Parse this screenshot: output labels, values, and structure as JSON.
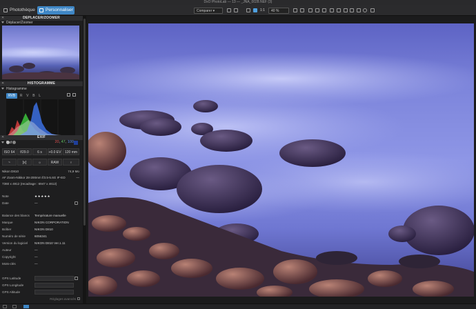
{
  "window": {
    "title": "DxO PhotoLab — 13 — _JNA_0028.NEF (3)"
  },
  "tabs": [
    {
      "label": "Photothèque",
      "icon": "library-icon"
    },
    {
      "label": "Personnaliser",
      "icon": "customize-icon"
    }
  ],
  "toolbar": {
    "compare_label": "Comparer",
    "ratio_label": "1:1",
    "zoom_value": "40 %",
    "accent": "#3f87c6"
  },
  "palettes": {
    "move_zoom": {
      "title": "DÉPLACER/ZOOMER",
      "subtitle": "Déplacer/Zoomer"
    },
    "histogram": {
      "title": "HISTOGRAMME",
      "subtitle": "Histogramme",
      "modes": [
        "RVB",
        "R",
        "V",
        "B",
        "L"
      ],
      "selected_mode": "RVB",
      "values": {
        "r": "20",
        "g": "47",
        "b": "100"
      }
    },
    "exif": {
      "title": "EXIF",
      "subtitle": "Exif",
      "cells_row1": [
        "ISO 64",
        "f/29.0",
        "6 s",
        "+0.0 EV",
        "120 mm"
      ],
      "cells_row2": [
        "~",
        "[≡]",
        "☼",
        "RAW",
        "♀"
      ],
      "camera": "Nikon D810",
      "file_size": "74,9 Mo",
      "lens": "AF Zoom-Nikkor 28-200mm f/3.5-5.6G IF-ED",
      "dimensions": "7360 x 4912 (recadrage : 6947 x 4612)",
      "dash": "—"
    },
    "metadata": [
      {
        "key": "Note",
        "value": "★★★★★"
      },
      {
        "key": "Date",
        "value": "—"
      },
      {
        "key": "Balance des blancs",
        "value": "Température manuelle"
      },
      {
        "key": "Marque",
        "value": "NIKON CORPORATION"
      },
      {
        "key": "Boîtier",
        "value": "NIKON D810"
      },
      {
        "key": "Numéro de série",
        "value": "6056341"
      },
      {
        "key": "Version du logiciel",
        "value": "NIKON D810 Ver.1.11"
      },
      {
        "key": "Auteur",
        "value": "—"
      },
      {
        "key": "Copyright",
        "value": "—"
      },
      {
        "key": "Mots-clés",
        "value": "—"
      }
    ],
    "gps": [
      {
        "key": "GPS Latitude"
      },
      {
        "key": "GPS Longitude"
      },
      {
        "key": "GPS Altitude"
      }
    ],
    "reset_label": "Réglages avancés"
  }
}
